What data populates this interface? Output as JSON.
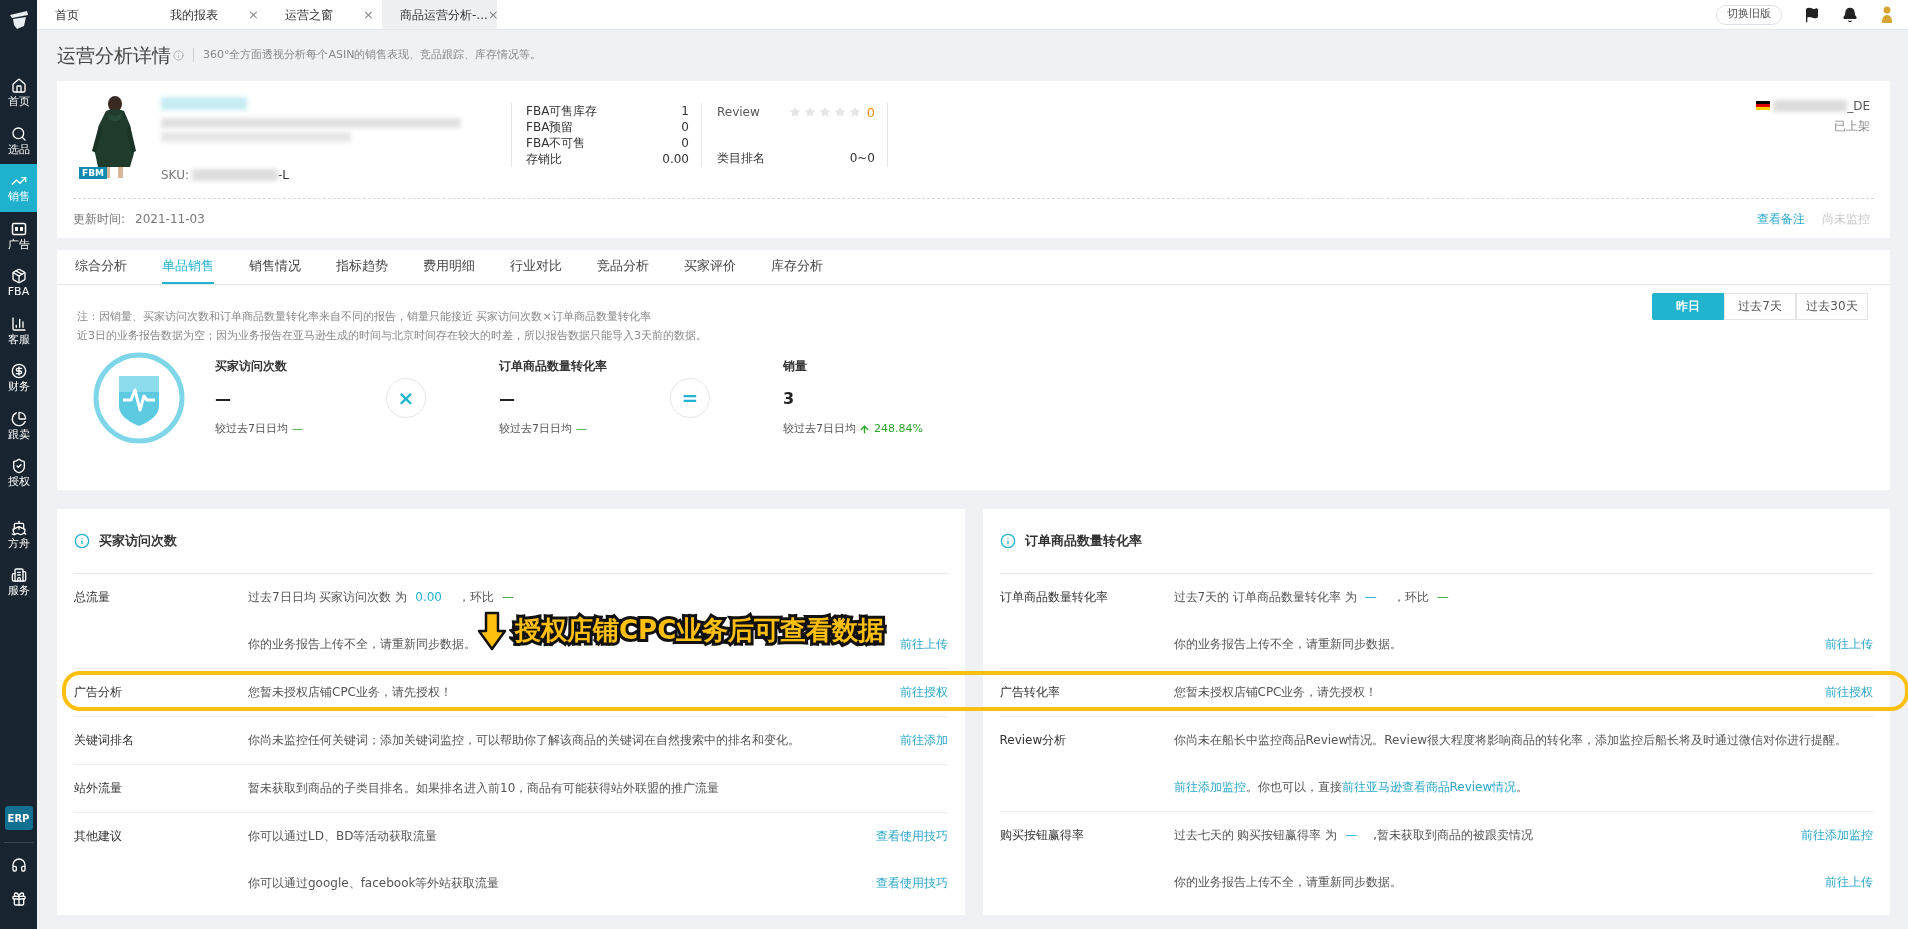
{
  "sidebar": {
    "items": [
      {
        "label": "首页",
        "selected": false
      },
      {
        "label": "选品",
        "selected": false
      },
      {
        "label": "销售",
        "selected": true
      },
      {
        "label": "广告",
        "selected": false
      },
      {
        "label": "FBA",
        "selected": false
      },
      {
        "label": "客服",
        "selected": false
      },
      {
        "label": "财务",
        "selected": false
      },
      {
        "label": "跟卖",
        "selected": false
      },
      {
        "label": "授权",
        "selected": false
      },
      {
        "label": "方舟",
        "selected": false
      },
      {
        "label": "服务",
        "selected": false
      }
    ],
    "erp": "ERP"
  },
  "tabs": [
    {
      "label": "首页",
      "closable": false,
      "selected": false
    },
    {
      "label": "我的报表",
      "closable": true,
      "selected": false
    },
    {
      "label": "运营之窗",
      "closable": true,
      "selected": false
    },
    {
      "label": "商品运营分析-...",
      "closable": true,
      "selected": true
    }
  ],
  "close_mark": "×",
  "switch_button": "切换旧版",
  "page": {
    "title": "运营分析详情",
    "subtitle": "360°全方面透视分析每个ASIN的销售表现、竞品跟踪、库存情况等。"
  },
  "product": {
    "badge": "FBM",
    "sku_label": "SKU:",
    "sku_suffix": "-L",
    "inventory": [
      {
        "label": "FBA可售库存",
        "value": "1"
      },
      {
        "label": "FBA预留",
        "value": "0"
      },
      {
        "label": "FBA不可售",
        "value": "0"
      },
      {
        "label": "存销比",
        "value": "0.00"
      }
    ],
    "review": {
      "label": "Review",
      "stars": 0,
      "count": "0"
    },
    "category_rank": {
      "label": "类目排名",
      "value": "0~0"
    },
    "store_suffix": "_DE",
    "status": "已上架",
    "updated_label": "更新时间:",
    "updated": "2021-11-03",
    "note_link": "查看备注",
    "monitor": {
      "label": "尚未监控",
      "disabled": true
    }
  },
  "analysis_tabs": [
    {
      "label": "综合分析",
      "selected": false
    },
    {
      "label": "单品销售",
      "selected": true
    },
    {
      "label": "销售情况",
      "selected": false
    },
    {
      "label": "指标趋势",
      "selected": false
    },
    {
      "label": "费用明细",
      "selected": false
    },
    {
      "label": "行业对比",
      "selected": false
    },
    {
      "label": "竞品分析",
      "selected": false
    },
    {
      "label": "买家评价",
      "selected": false
    },
    {
      "label": "库存分析",
      "selected": false
    }
  ],
  "notes": [
    "注：因销量、买家访问次数和订单商品数量转化率来自不同的报告，销量只能接近 买家访问次数×订单商品数量转化率",
    "近3日的业务报告数据为空；因为业务报告在亚马逊生成的时间与北京时间存在较大的时差，所以报告数据只能导入3天前的数据。"
  ],
  "ranges": [
    {
      "label": "昨日",
      "selected": true
    },
    {
      "label": "过去7天",
      "selected": false
    },
    {
      "label": "过去30天",
      "selected": false
    }
  ],
  "metrics": [
    {
      "label": "买家访问次数",
      "value": "—",
      "compare_label": "较过去7日日均",
      "change": "—",
      "rising": false
    },
    {
      "label": "订单商品数量转化率",
      "value": "—",
      "compare_label": "较过去7日日均",
      "change": "—",
      "rising": false
    },
    {
      "label": "销量",
      "value": "3",
      "compare_label": "较过去7日日均",
      "change": "248.84%",
      "rising": true
    }
  ],
  "operators": [
    "×",
    "="
  ],
  "panels": [
    {
      "title": "买家访问次数",
      "rows": [
        {
          "label": "总流量",
          "lines": [
            {
              "parts": [
                {
                  "kind": "plain",
                  "text": "过去7日日均 买家访问次数 为"
                },
                {
                  "kind": "value",
                  "text": "0.00"
                },
                {
                  "kind": "plain",
                  "text": "，环比"
                },
                {
                  "kind": "change",
                  "text": "—"
                }
              ]
            },
            {
              "parts": [
                {
                  "kind": "plain",
                  "text": "你的业务报告上传不全，请重新同步数据。"
                }
              ],
              "action": "前往上传"
            }
          ]
        },
        {
          "label": "广告分析",
          "lines": [
            {
              "parts": [
                {
                  "kind": "plain",
                  "text": "您暂未授权店铺CPC业务，请先授权！"
                }
              ],
              "action": "前往授权"
            }
          ]
        },
        {
          "label": "关键词排名",
          "lines": [
            {
              "parts": [
                {
                  "kind": "plain",
                  "text": "你尚未监控任何关键词；添加关键词监控，可以帮助你了解该商品的关键词在自然搜索中的排名和变化。"
                }
              ],
              "action": "前往添加"
            }
          ]
        },
        {
          "label": "站外流量",
          "lines": [
            {
              "parts": [
                {
                  "kind": "plain",
                  "text": "暂未获取到商品的子类目排名。如果排名进入前10，商品有可能获得站外联盟的推广流量"
                }
              ]
            }
          ]
        },
        {
          "label": "其他建议",
          "lines": [
            {
              "parts": [
                {
                  "kind": "plain",
                  "text": "你可以通过LD、BD等活动获取流量"
                }
              ],
              "action": "查看使用技巧"
            },
            {
              "parts": [
                {
                  "kind": "plain",
                  "text": "你可以通过google、facebook等外站获取流量"
                }
              ],
              "action": "查看使用技巧"
            }
          ]
        }
      ]
    },
    {
      "title": "订单商品数量转化率",
      "rows": [
        {
          "label": "订单商品数量转化率",
          "lines": [
            {
              "parts": [
                {
                  "kind": "plain",
                  "text": "过去7天的 订单商品数量转化率 为"
                },
                {
                  "kind": "value",
                  "text": "—"
                },
                {
                  "kind": "plain",
                  "text": "，环比"
                },
                {
                  "kind": "change",
                  "text": "—"
                }
              ]
            },
            {
              "parts": [
                {
                  "kind": "plain",
                  "text": "你的业务报告上传不全，请重新同步数据。"
                }
              ],
              "action": "前往上传"
            }
          ]
        },
        {
          "label": "广告转化率",
          "lines": [
            {
              "parts": [
                {
                  "kind": "plain",
                  "text": "您暂未授权店铺CPC业务，请先授权！"
                }
              ],
              "action": "前往授权"
            }
          ]
        },
        {
          "label": "Review分析",
          "lines": [
            {
              "parts": [
                {
                  "kind": "plain",
                  "text": "你尚未在船长中监控商品Review情况。Review很大程度将影响商品的转化率，添加监控后船长将及时通过微信对你进行提醒。"
                }
              ]
            },
            {
              "parts": [
                {
                  "kind": "link",
                  "text": "前往添加监控"
                },
                {
                  "kind": "plain",
                  "text": "。你也可以，直接"
                },
                {
                  "kind": "link",
                  "text": "前往亚马逊查看商品Review情况"
                },
                {
                  "kind": "plain",
                  "text": "。"
                }
              ]
            }
          ]
        },
        {
          "label": "购买按钮赢得率",
          "lines": [
            {
              "parts": [
                {
                  "kind": "plain",
                  "text": "过去七天的 购买按钮赢得率 为"
                },
                {
                  "kind": "value",
                  "text": "—"
                },
                {
                  "kind": "plain",
                  "text": ",暂未获取到商品的被跟卖情况"
                }
              ],
              "action": "前往添加监控"
            },
            {
              "parts": [
                {
                  "kind": "plain",
                  "text": "你的业务报告上传不全，请重新同步数据。"
                }
              ],
              "action": "前往上传"
            }
          ]
        }
      ]
    }
  ],
  "annotation": {
    "text": "授权店铺CPC业务后可查看数据"
  }
}
